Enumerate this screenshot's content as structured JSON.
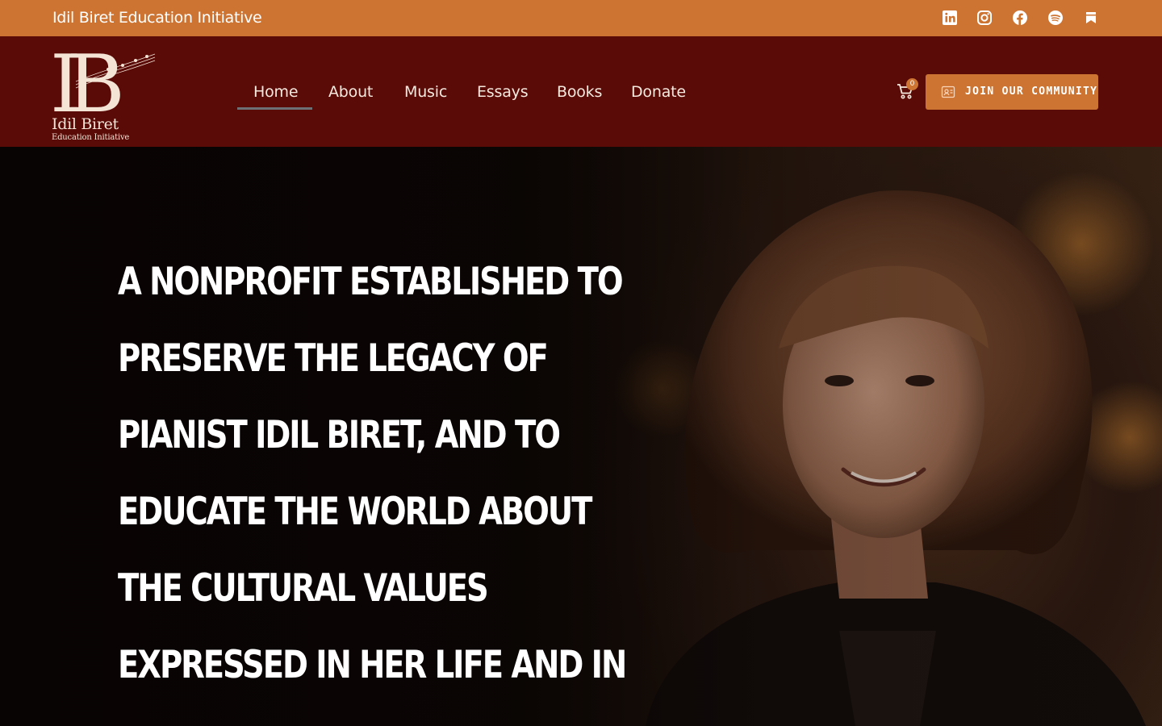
{
  "topbar": {
    "title": "Idil Biret Education Initiative",
    "bg": "#cd7433",
    "social_icons": [
      "linkedin-icon",
      "instagram-icon",
      "facebook-icon",
      "spotify-icon",
      "bookmark-icon"
    ]
  },
  "logo": {
    "monogram": "IB",
    "name": "Idil Biret",
    "subtitle": "Education Initiative"
  },
  "nav": {
    "items": [
      {
        "label": "Home",
        "active": true
      },
      {
        "label": "About"
      },
      {
        "label": "Music"
      },
      {
        "label": "Essays"
      },
      {
        "label": "Books"
      },
      {
        "label": "Donate"
      }
    ]
  },
  "cart": {
    "count": "0",
    "icon": "cart-icon"
  },
  "cta": {
    "label": "JOIN OUR COMMUNITY",
    "icon": "contact-card-icon"
  },
  "hero": {
    "lines": [
      "A NONPROFIT ESTABLISHED TO",
      "PRESERVE THE LEGACY OF",
      "PIANIST IDIL BIRET, AND TO",
      "EDUCATE THE WORLD ABOUT",
      "THE CULTURAL VALUES",
      "EXPRESSED IN HER LIFE AND IN"
    ]
  },
  "colors": {
    "accent": "#cd7433",
    "header": "#5a0a07"
  }
}
